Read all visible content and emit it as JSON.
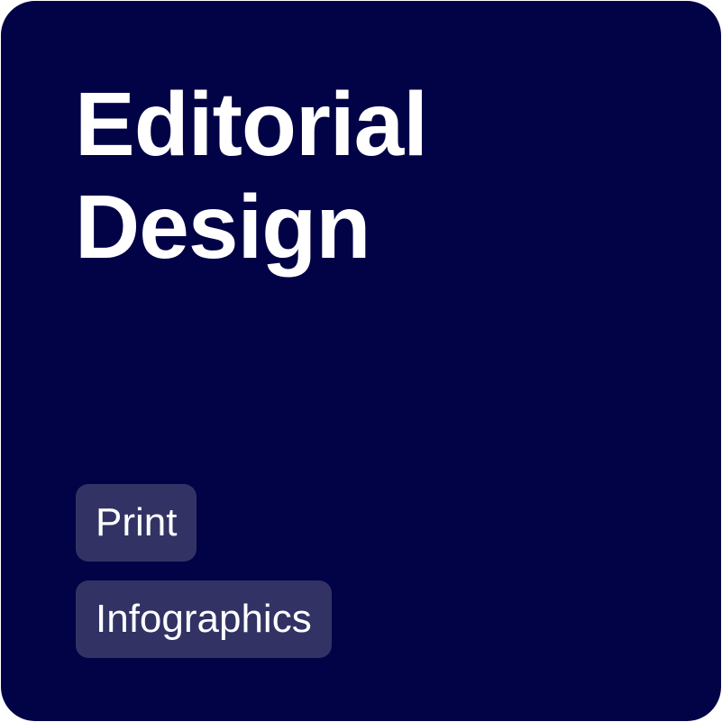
{
  "card": {
    "title_line1": "Editorial",
    "title_line2": "Design",
    "background_color": "#020346"
  },
  "tags": [
    {
      "label": "Print"
    },
    {
      "label": "Infographics"
    }
  ],
  "colors": {
    "text": "#ffffff",
    "tag_background": "#323364"
  }
}
